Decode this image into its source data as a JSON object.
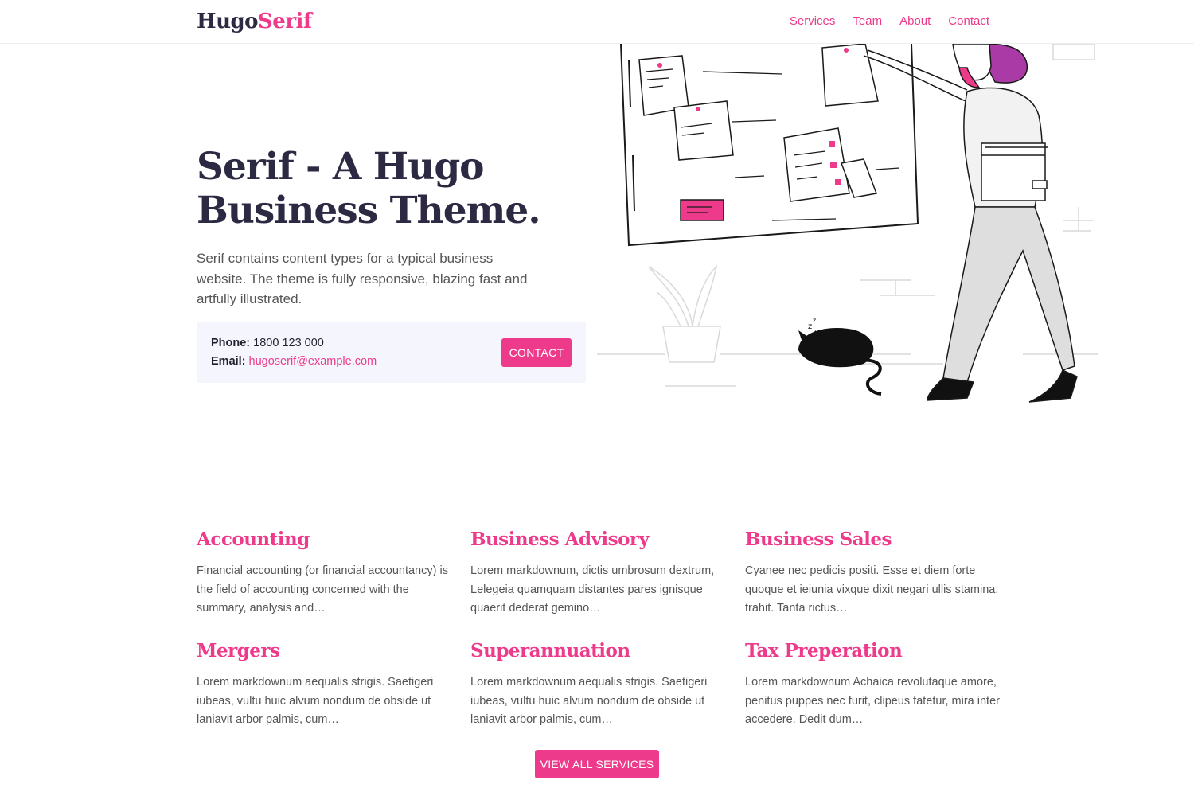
{
  "header": {
    "logo_part1": "Hugo",
    "logo_part2": "Serif",
    "nav": [
      "Services",
      "Team",
      "About",
      "Contact"
    ]
  },
  "hero": {
    "title": "Serif - A Hugo Business Theme.",
    "description": "Serif contains content types for a typical business website. The theme is fully responsive, blazing fast and artfully illustrated.",
    "phone_label": "Phone:",
    "phone_value": "1800 123 000",
    "email_label": "Email:",
    "email_value": "hugoserif@example.com",
    "contact_button": "CONTACT"
  },
  "services": [
    {
      "title": "Accounting",
      "text": "Financial accounting (or financial accountancy) is the field of accounting concerned with the summary, analysis and…"
    },
    {
      "title": "Business Advisory",
      "text": "Lorem markdownum, dictis umbrosum dextrum, Lelegeia quamquam distantes pares ignisque quaerit dederat gemino…"
    },
    {
      "title": "Business Sales",
      "text": "Cyanee nec pedicis positi. Esse et diem forte quoque et ieiunia vixque dixit negari ullis stamina: trahit. Tanta rictus…"
    },
    {
      "title": "Mergers",
      "text": "Lorem markdownum aequalis strigis. Saetigeri iubeas, vultu huic alvum nondum de obside ut laniavit arbor palmis, cum…"
    },
    {
      "title": "Superannuation",
      "text": "Lorem markdownum aequalis strigis. Saetigeri iubeas, vultu huic alvum nondum de obside ut laniavit arbor palmis, cum…"
    },
    {
      "title": "Tax Preperation",
      "text": "Lorem markdownum Achaica revolutaque amore, penitus puppes nec furit, clipeus fatetur, mira inter accedere. Dedit dum…"
    }
  ],
  "view_all_button": "VIEW ALL SERVICES",
  "colors": {
    "accent": "#ee3a8a",
    "heading": "#2b2a42",
    "body_text": "#555555",
    "contact_bg": "#f5f6fd"
  }
}
